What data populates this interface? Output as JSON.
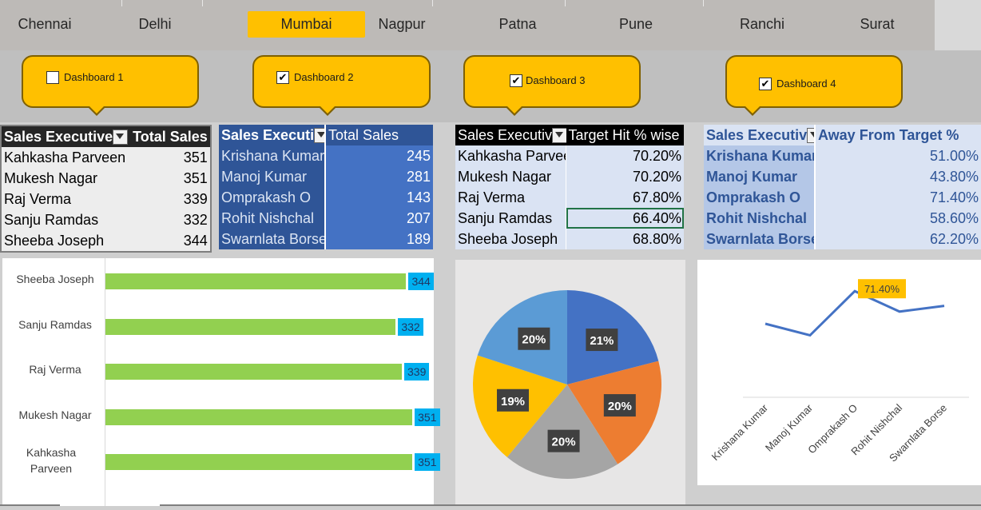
{
  "slicer": {
    "cities": [
      "Chennai",
      "Delhi",
      "Mumbai",
      "Nagpur",
      "Patna",
      "Pune",
      "Ranchi",
      "Surat"
    ],
    "selected": "Mumbai"
  },
  "dashboards": [
    {
      "label": "Dashboard 1",
      "checked": false
    },
    {
      "label": "Dashboard 2",
      "checked": true
    },
    {
      "label": "Dashboard 3",
      "checked": true
    },
    {
      "label": "Dashboard 4",
      "checked": true
    }
  ],
  "table1": {
    "headers": [
      "Sales Executive",
      "Total Sales"
    ],
    "rows": [
      [
        "Kahkasha Parveen",
        "351"
      ],
      [
        "Mukesh Nagar",
        "351"
      ],
      [
        "Raj Verma",
        "339"
      ],
      [
        "Sanju Ramdas",
        "332"
      ],
      [
        "Sheeba Joseph",
        "344"
      ]
    ]
  },
  "table2": {
    "headers": [
      "Sales Executi",
      "Total Sales"
    ],
    "rows": [
      [
        "Krishana Kumar",
        "245"
      ],
      [
        "Manoj Kumar",
        "281"
      ],
      [
        "Omprakash O",
        "143"
      ],
      [
        "Rohit Nishchal",
        "207"
      ],
      [
        "Swarnlata Borse",
        "189"
      ]
    ]
  },
  "table3": {
    "headers": [
      "Sales Executiv",
      "Target Hit % wise"
    ],
    "rows": [
      [
        "Kahkasha Parvee",
        "70.20%"
      ],
      [
        "Mukesh Nagar",
        "70.20%"
      ],
      [
        "Raj Verma",
        "67.80%"
      ],
      [
        "Sanju Ramdas",
        "66.40%"
      ],
      [
        "Sheeba Joseph",
        "68.80%"
      ]
    ]
  },
  "table4": {
    "headers": [
      "Sales Executiv",
      "Away From Target %"
    ],
    "rows": [
      [
        "Krishana Kumar",
        "51.00%"
      ],
      [
        "Manoj Kumar",
        "43.80%"
      ],
      [
        "Omprakash O",
        "71.40%"
      ],
      [
        "Rohit Nishchal",
        "58.60%"
      ],
      [
        "Swarnlata Borse",
        "62.20%"
      ]
    ]
  },
  "chart_data": [
    {
      "type": "bar",
      "orientation": "horizontal",
      "categories": [
        "Sheeba Joseph",
        "Sanju Ramdas",
        "Raj Verma",
        "Mukesh Nagar",
        "Kahkasha Parveen"
      ],
      "values": [
        344,
        332,
        339,
        351,
        351
      ],
      "data_labels": [
        "344",
        "332",
        "339",
        "351",
        "351"
      ],
      "xlim": [
        0,
        360
      ],
      "bar_color": "#92d050",
      "label_color": "#00b0f0"
    },
    {
      "type": "pie",
      "values": [
        21,
        20,
        20,
        19,
        20
      ],
      "labels": [
        "21%",
        "20%",
        "20%",
        "19%",
        "20%"
      ],
      "colors": [
        "#4472c4",
        "#ed7d31",
        "#a5a5a5",
        "#ffc000",
        "#5b9bd5"
      ]
    },
    {
      "type": "line",
      "categories": [
        "Krishana Kumar",
        "Manoj Kumar",
        "Omprakash O",
        "Rohit Nishchal",
        "Swarnlata Borse"
      ],
      "values": [
        51.0,
        43.8,
        71.4,
        58.6,
        62.2
      ],
      "highlight_label": "71.40%",
      "line_color": "#4472c4"
    }
  ]
}
